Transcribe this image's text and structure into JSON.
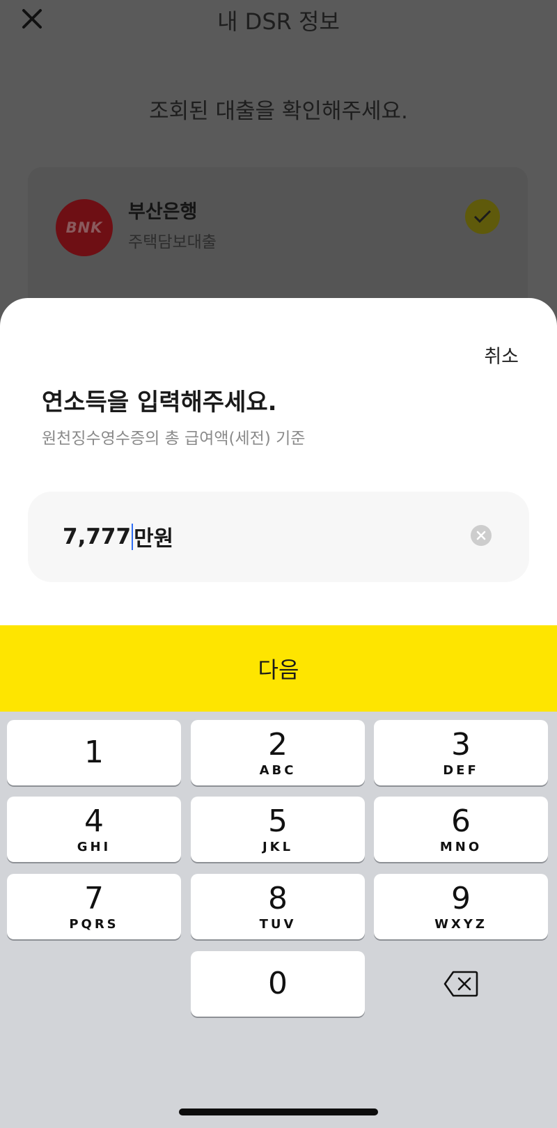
{
  "header": {
    "title": "내 DSR 정보"
  },
  "background": {
    "subtitle": "조회된 대출을 확인해주세요.",
    "loan": {
      "logo_text": "BNK",
      "bank_name": "부산은행",
      "loan_type": "주택담보대출",
      "checked": true
    }
  },
  "sheet": {
    "cancel_label": "취소",
    "title": "연소득을 입력해주세요.",
    "description": "원천징수영수증의 총 급여액(세전) 기준",
    "input": {
      "value": "7,777",
      "unit": "만원"
    },
    "next_label": "다음"
  },
  "keypad": {
    "keys": [
      {
        "num": "1",
        "letters": ""
      },
      {
        "num": "2",
        "letters": "ABC"
      },
      {
        "num": "3",
        "letters": "DEF"
      },
      {
        "num": "4",
        "letters": "GHI"
      },
      {
        "num": "5",
        "letters": "JKL"
      },
      {
        "num": "6",
        "letters": "MNO"
      },
      {
        "num": "7",
        "letters": "PQRS"
      },
      {
        "num": "8",
        "letters": "TUV"
      },
      {
        "num": "9",
        "letters": "WXYZ"
      },
      {
        "num": "0",
        "letters": ""
      }
    ]
  },
  "colors": {
    "accent": "#fee500",
    "caret": "#2f6ef5",
    "bank_logo": "#a51b24"
  }
}
